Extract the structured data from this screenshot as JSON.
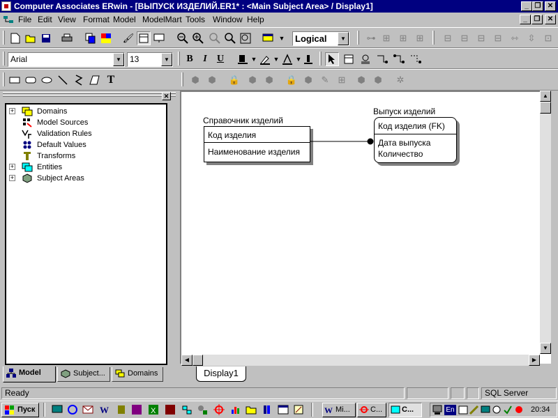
{
  "window": {
    "title": "Computer Associates ERwin - [ВЫПУСК ИЗДЕЛИЙ.ER1* : <Main Subject Area> / Display1]"
  },
  "menu": {
    "items": [
      "File",
      "Edit",
      "View",
      "Format",
      "Model",
      "ModelMart",
      "Tools",
      "Window",
      "Help"
    ]
  },
  "toolbar": {
    "view_mode": "Logical",
    "font_name": "Arial",
    "font_size": "13",
    "bold_label": "B",
    "italic_label": "I",
    "underline_label": "U",
    "text_tool_label": "T"
  },
  "tree": {
    "items": [
      {
        "label": "Domains",
        "expandable": true,
        "icon": "domains-icon"
      },
      {
        "label": "Model Sources",
        "expandable": false,
        "icon": "model-sources-icon"
      },
      {
        "label": "Validation Rules",
        "expandable": false,
        "icon": "validation-rules-icon"
      },
      {
        "label": "Default Values",
        "expandable": false,
        "icon": "default-values-icon"
      },
      {
        "label": "Transforms",
        "expandable": false,
        "icon": "transforms-icon"
      },
      {
        "label": "Entities",
        "expandable": true,
        "icon": "entities-icon"
      },
      {
        "label": "Subject Areas",
        "expandable": true,
        "icon": "subject-areas-icon"
      }
    ],
    "tabs": [
      "Model",
      "Subject...",
      "Domains"
    ]
  },
  "diagram": {
    "entities": [
      {
        "name": "Справочник изделий",
        "key": "Код изделия",
        "attributes": [
          "Наименование изделия"
        ]
      },
      {
        "name": "Выпуск изделий",
        "key": "Код изделия (FK)",
        "attributes": [
          "Дата выпуска",
          "Количество"
        ]
      }
    ],
    "tab": "Display1"
  },
  "status": {
    "text": "Ready",
    "db": "SQL Server"
  },
  "taskbar": {
    "start": "Пуск",
    "tasks": [
      "Mi...",
      "C...",
      "C..."
    ],
    "clock": "20:34",
    "lang": "En"
  },
  "colors": {
    "title_bg": "#000080",
    "face": "#c0c0c0",
    "shadow": "#808080"
  }
}
